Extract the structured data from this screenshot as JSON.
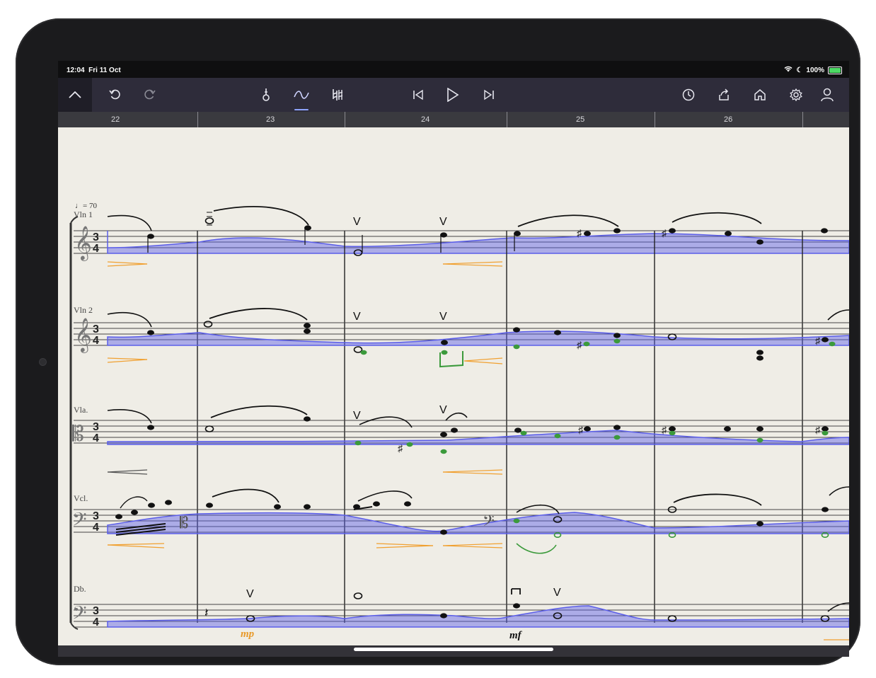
{
  "status_bar": {
    "time": "12:04",
    "date": "Fri 11 Oct",
    "battery": "100%"
  },
  "toolbar": {
    "icons": [
      "chevron-up-icon",
      "undo-icon",
      "redo-icon",
      "pen-nib-icon",
      "curve-tool-icon",
      "natural-sharp-icon",
      "skip-back-icon",
      "play-icon",
      "skip-forward-icon",
      "clock-icon",
      "share-icon",
      "home-icon",
      "settings-icon",
      "profile-icon"
    ],
    "active_tool": "curve-tool-icon",
    "accent_color": "#8ea4ff"
  },
  "ruler": {
    "measures": [
      "22",
      "23",
      "24",
      "25",
      "26"
    ]
  },
  "score": {
    "tempo": "♩= 70",
    "time_signature": "3/4",
    "staves": [
      {
        "name": "Vln 1"
      },
      {
        "name": "Vln 2"
      },
      {
        "name": "Vla."
      },
      {
        "name": "Vcl."
      },
      {
        "name": "Db."
      }
    ],
    "dynamics": [
      "mp",
      "mf"
    ],
    "curve_fill_color": "#5b5ee8",
    "note_color": "#111111",
    "ghost_note_color": "#3b9a3b",
    "hairpin_color": "#f0a030"
  }
}
